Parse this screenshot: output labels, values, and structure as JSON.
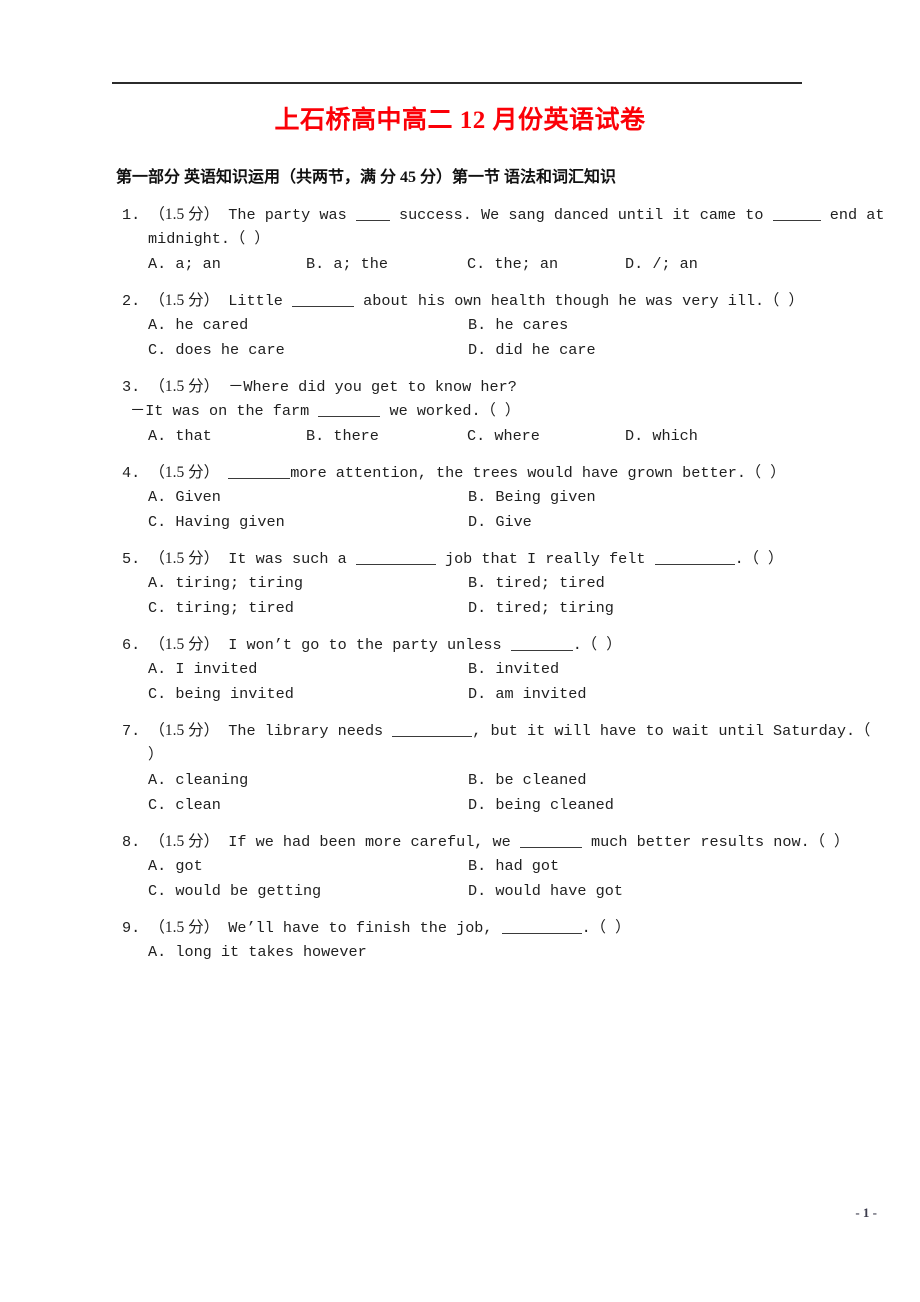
{
  "document": {
    "title": "上石桥高中高二 12 月份英语试卷",
    "title_color": "#fb0007",
    "section_heading": "第一部分 英语知识运用（共两节，满 分 45 分）第一节 语法和词汇知识",
    "page_number": "- 1 -"
  },
  "questions": [
    {
      "number": "1.",
      "marks": "（1.5 分）",
      "lines": [
        "The party was ____ success. We sang danced until it came to _____ end at",
        "midnight.（    ）"
      ],
      "layout": "cols4",
      "options": [
        "A. a;  an",
        "B. a;  the",
        "C. the;  an",
        "D. /;  an"
      ]
    },
    {
      "number": "2.",
      "marks": "（1.5 分）",
      "lines": [
        "Little ______ about his own health though he was very ill.（    ）"
      ],
      "layout": "cols2",
      "options": [
        "A. he cared",
        "B. he cares",
        "C. does he care",
        "D. did he care"
      ]
    },
    {
      "number": "3.",
      "marks": "（1.5 分）",
      "lines": [
        "－Where did you get to know her?",
        "－It was on the farm ______ we worked.（    ）"
      ],
      "layout": "cols4",
      "options": [
        "A. that",
        "B. there",
        "C. where",
        "D. which"
      ]
    },
    {
      "number": "4.",
      "marks": "（1.5 分）",
      "lines": [
        "________more attention, the trees would have grown better.（    ）"
      ],
      "layout": "cols2",
      "options": [
        "A. Given",
        "B. Being given",
        "C. Having given",
        "D. Give"
      ]
    },
    {
      "number": "5.",
      "marks": "（1.5 分）",
      "lines": [
        "It was such a __________ job that I really felt __________.（    ）"
      ],
      "layout": "cols2",
      "options": [
        "A. tiring;  tiring",
        "B. tired;  tired",
        "C. tiring;  tired",
        "D. tired;  tiring"
      ]
    },
    {
      "number": "6.",
      "marks": "（1.5 分）",
      "lines": [
        "I won’t go to the party unless _______.（    ）"
      ],
      "layout": "cols2",
      "options": [
        "A. I invited",
        "B. invited",
        "C. being invited",
        "D. am invited"
      ]
    },
    {
      "number": "7.",
      "marks": "（1.5 分）",
      "lines": [
        "The library needs __________, but it will have to wait until Saturday.（",
        "）"
      ],
      "layout": "cols2",
      "options": [
        "A. cleaning",
        "B. be cleaned",
        "C. clean",
        "D. being cleaned"
      ]
    },
    {
      "number": "8.",
      "marks": "（1.5 分）",
      "lines": [
        "If we had been more careful, we ______ much better results now.（    ）"
      ],
      "layout": "cols2",
      "options": [
        "A. got",
        "B. had got",
        "C. would be getting",
        "D. would have got"
      ]
    },
    {
      "number": "9.",
      "marks": "（1.5 分）",
      "lines": [
        "We’ll have to finish the job, __________.（    ）"
      ],
      "layout": "cols2",
      "options": [
        "A. long it takes however"
      ]
    }
  ]
}
